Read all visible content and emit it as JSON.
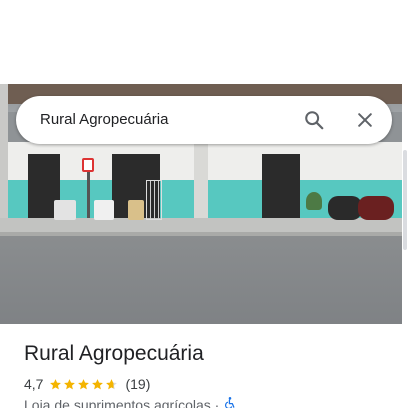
{
  "search": {
    "query": "Rural Agropecuária",
    "search_icon": "search-icon",
    "close_icon": "close-icon"
  },
  "place": {
    "name": "Rural Agropecuária",
    "rating": "4,7",
    "stars_value": 4.7,
    "stars_max": 5,
    "review_count": "(19)",
    "category": "Loja de suprimentos agrícolas ·",
    "accessibility_icon": "wheelchair-accessible-icon"
  },
  "colors": {
    "star": "#f4b400",
    "accessible": "#1a73e8",
    "text_primary": "#202124",
    "text_secondary": "#5f6368"
  }
}
